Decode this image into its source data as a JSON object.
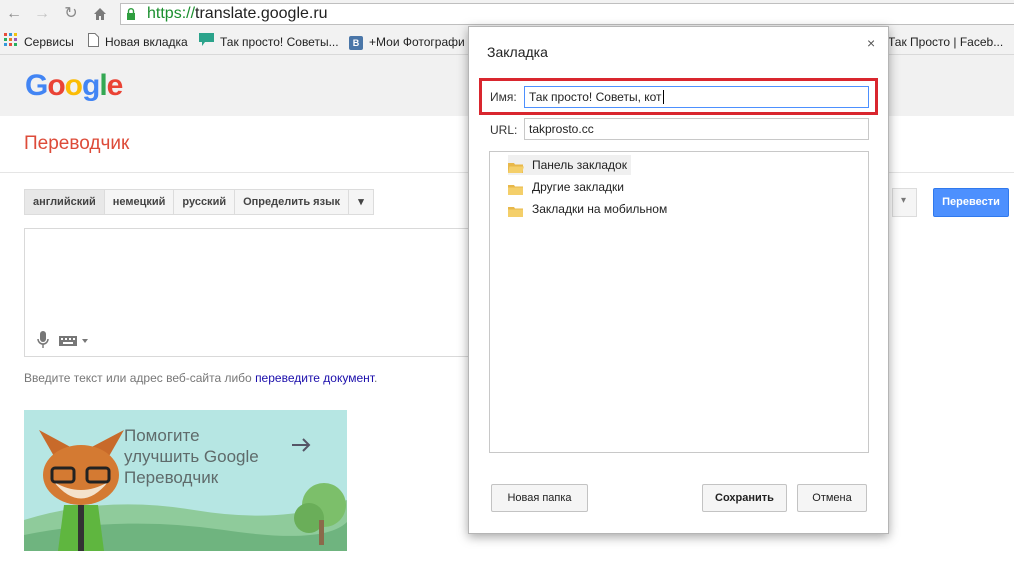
{
  "browser": {
    "url_scheme": "https://",
    "url_host": "translate.google.ru",
    "bookmarks": [
      {
        "label": "Сервисы",
        "icon": "apps-grid-icon"
      },
      {
        "label": "Новая вкладка",
        "icon": "page-icon"
      },
      {
        "label": "Так просто! Советы...",
        "icon": "chat-bubble-icon"
      },
      {
        "label": "+Мои Фотографи",
        "icon": "vk-icon"
      },
      {
        "label": "Так Просто | Faceb...",
        "icon": "facebook-icon"
      }
    ]
  },
  "translate": {
    "logo": [
      "G",
      "o",
      "o",
      "g",
      "l",
      "e"
    ],
    "title": "Переводчик",
    "source_langs": [
      "английский",
      "немецкий",
      "русский",
      "Определить язык"
    ],
    "hint_prefix": "Введите текст или адрес веб-сайта либо ",
    "hint_link": "переведите документ",
    "hint_suffix": ".",
    "banner_line1": "Помогите",
    "banner_line2": "улучшить Google",
    "banner_line3": "Переводчик",
    "translate_button": "Перевести"
  },
  "dialog": {
    "title": "Закладка",
    "name_label": "Имя:",
    "name_value": "Так просто! Советы, кот",
    "url_label": "URL:",
    "url_value": "takprosto.cc",
    "folders": [
      "Панель закладок",
      "Другие закладки",
      "Закладки на мобильном"
    ],
    "new_folder_button": "Новая папка",
    "save_button": "Сохранить",
    "cancel_button": "Отмена",
    "close_glyph": "×"
  },
  "colors": {
    "google_blue": "#4285f4",
    "google_red": "#ea4335",
    "google_yellow": "#fbbc05",
    "google_green": "#34a853",
    "highlight_red": "#d9262e",
    "translate_button": "#4d90fe"
  }
}
